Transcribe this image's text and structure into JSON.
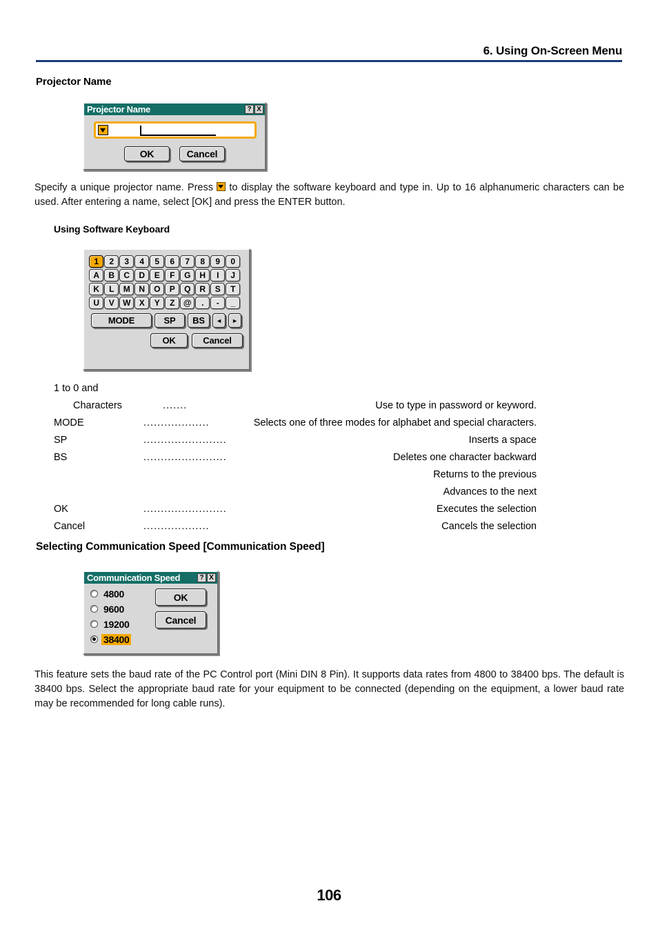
{
  "header": {
    "running_head": "6. Using On-Screen Menu",
    "rule_color": "#1b3a77"
  },
  "sections": {
    "projector_name_heading": "Projector Name",
    "software_keyboard_heading": "Using Software Keyboard",
    "comm_speed_heading": "Selecting Communication Speed [Communication Speed]"
  },
  "paragraphs": {
    "intro_before_icon": "Specify a unique projector name. Press",
    "intro_after_icon": "to display the software keyboard and type in. Up to 16 alphanumeric characters can be used. After entering a name, select [OK] and press the ENTER button.",
    "comm_speed": "This feature sets the baud rate of the PC Control port (Mini DIN 8 Pin). It supports data rates from 4800 to 38400 bps. The default is 38400 bps. Select the appropriate baud rate for your equipment to be connected (depending on the equipment, a lower baud rate may be recommended for long cable runs)."
  },
  "projector_name_dialog": {
    "title": "Projector Name",
    "help_button": "?",
    "close_button": "X",
    "input_value": "",
    "dropdown_icon": "dropdown-arrow-icon",
    "ok_label": "OK",
    "cancel_label": "Cancel",
    "titlebar_color": "#146e66",
    "field_border_color": "#f5a800"
  },
  "software_keyboard": {
    "rows": [
      [
        "1",
        "2",
        "3",
        "4",
        "5",
        "6",
        "7",
        "8",
        "9",
        "0"
      ],
      [
        "A",
        "B",
        "C",
        "D",
        "E",
        "F",
        "G",
        "H",
        "I",
        "J"
      ],
      [
        "K",
        "L",
        "M",
        "N",
        "O",
        "P",
        "Q",
        "R",
        "S",
        "T"
      ],
      [
        "U",
        "V",
        "W",
        "X",
        "Y",
        "Z",
        "@",
        ".",
        "-",
        "_"
      ]
    ],
    "selected_key": "1",
    "mode_label": "MODE",
    "sp_label": "SP",
    "bs_label": "BS",
    "left_arrow": "◄",
    "right_arrow": "►",
    "ok_label": "OK",
    "cancel_label": "Cancel",
    "highlight_color": "#f5a800"
  },
  "keyboard_legend": [
    {
      "term": "1 to 0 and",
      "dots": "",
      "desc": "",
      "full_line": true
    },
    {
      "term": "Characters",
      "dots": ".......",
      "desc": "Use to type in password or keyword.",
      "indent": true
    },
    {
      "term": "MODE",
      "dots": "...................",
      "desc": "Selects one of three modes for alphabet and special characters."
    },
    {
      "term": "SP",
      "dots": "........................",
      "desc": "Inserts a space"
    },
    {
      "term": "BS",
      "dots": "........................",
      "desc": "Deletes one character backward"
    },
    {
      "term": "",
      "dots": "",
      "desc": "Returns to the previous",
      "continuation": true
    },
    {
      "term": "",
      "dots": "",
      "desc": "Advances to the next",
      "continuation": true
    },
    {
      "term": "OK",
      "dots": "........................",
      "desc": "Executes the selection"
    },
    {
      "term": "Cancel",
      "dots": "...................",
      "desc": "Cancels the selection"
    }
  ],
  "comm_speed_dialog": {
    "title": "Communication Speed",
    "help_button": "?",
    "close_button": "X",
    "options": [
      {
        "label": "4800",
        "selected": false
      },
      {
        "label": "9600",
        "selected": false
      },
      {
        "label": "19200",
        "selected": false
      },
      {
        "label": "38400",
        "selected": true
      }
    ],
    "ok_label": "OK",
    "cancel_label": "Cancel",
    "titlebar_color": "#146e66",
    "highlight_color": "#f5a800"
  },
  "page_number": "106"
}
